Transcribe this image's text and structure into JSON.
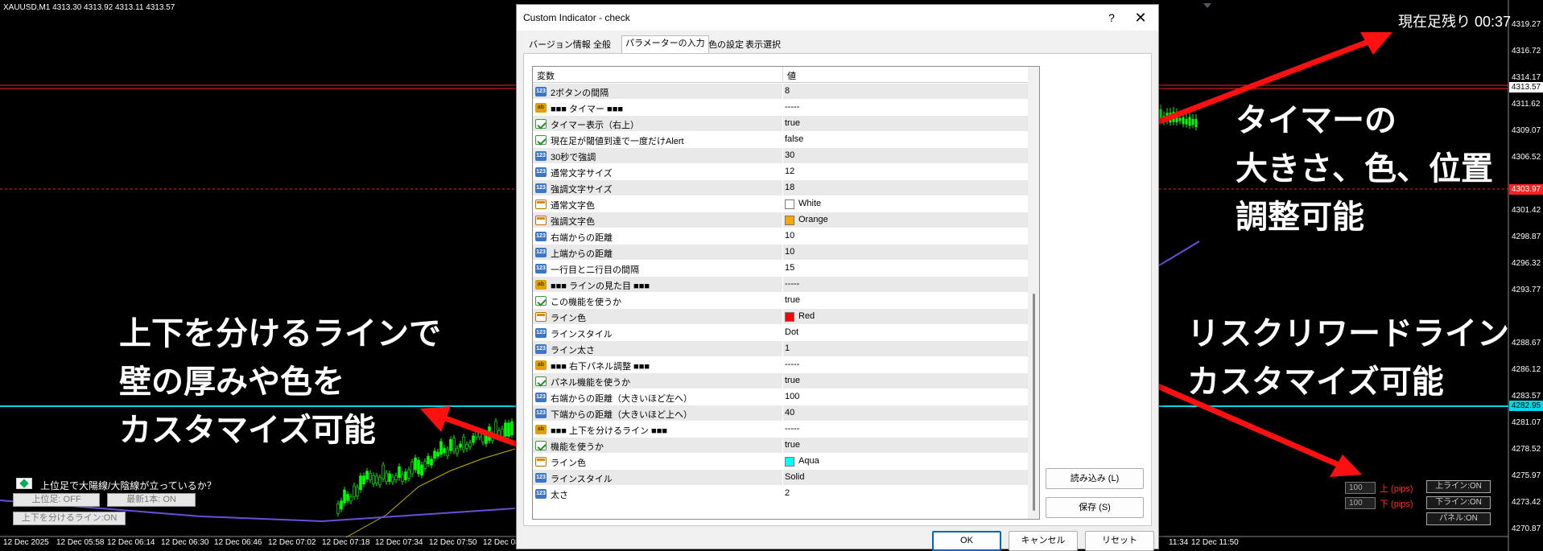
{
  "chart": {
    "symbol_info": "XAUUSD,M1  4313.30 4313.92 4313.11 4313.57",
    "timer_text": "現在足残り 00:37",
    "price_ticks": [
      "4319.27",
      "4316.72",
      "4314.17",
      "4311.62",
      "4309.07",
      "4306.52",
      "4301.42",
      "4298.87",
      "4296.32",
      "4293.77",
      "4288.67",
      "4286.12",
      "4283.57",
      "4281.07",
      "4278.52",
      "4275.97",
      "4273.42",
      "4270.87"
    ],
    "badges": {
      "current": "4313.57",
      "red_level": "4303.97",
      "aqua_level": "4282.95"
    },
    "time_ticks": [
      "12 Dec 2025",
      "12 Dec 05:58",
      "12 Dec 06:14",
      "12 Dec 06:30",
      "12 Dec 06:46",
      "12 Dec 07:02",
      "12 Dec 07:18",
      "12 Dec 07:34",
      "12 Dec 07:50",
      "12 Dec 08:06",
      "11:34",
      "12 Dec 11:50"
    ]
  },
  "annotations": {
    "timer_line1": "タイマーの",
    "timer_line2": "大きさ、色、位置",
    "timer_line3": "調整可能",
    "divider_line1": "上下を分けるラインで",
    "divider_line2": "壁の厚みや色を",
    "divider_line3": "カスタマイズ可能",
    "rr_line1": "リスクリワードライン",
    "rr_line2": "カスタマイズ可能"
  },
  "left_panel": {
    "question": "上位足で大陽線/大陰線が立っているか？",
    "btn_higher_tf": "上位足: OFF",
    "btn_latest": "最新1本: ON",
    "btn_divider": "上下を分けるライン:ON"
  },
  "right_panel": {
    "upper_value": "100",
    "upper_label": "上 (pips)",
    "lower_value": "100",
    "lower_label": "下 (pips)",
    "btn_upper_line": "上ライン:ON",
    "btn_lower_line": "下ライン:ON",
    "btn_panel": "パネル:ON"
  },
  "dialog": {
    "title": "Custom Indicator - check",
    "help": "?",
    "close": "✕",
    "tabs": [
      "バージョン情報",
      "全般",
      "パラメーターの入力",
      "色の設定",
      "表示選択"
    ],
    "active_tab": 2,
    "col_variable": "変数",
    "col_value": "値",
    "params": [
      {
        "type": "num",
        "name": "2ボタンの間隔",
        "value": "8"
      },
      {
        "type": "str",
        "name": "■■■ タイマー ■■■",
        "value": "-----"
      },
      {
        "type": "bool",
        "name": "タイマー表示（右上）",
        "value": "true"
      },
      {
        "type": "bool",
        "name": "現在足が閾値到達で一度だけAlert",
        "value": "false"
      },
      {
        "type": "num",
        "name": "30秒で強調",
        "value": "30"
      },
      {
        "type": "num",
        "name": "通常文字サイズ",
        "value": "12"
      },
      {
        "type": "num",
        "name": "強調文字サイズ",
        "value": "18"
      },
      {
        "type": "col",
        "name": "通常文字色",
        "value": "White",
        "color": "#ffffff"
      },
      {
        "type": "col",
        "name": "強調文字色",
        "value": "Orange",
        "color": "#ffa500"
      },
      {
        "type": "num",
        "name": "右端からの距離",
        "value": "10"
      },
      {
        "type": "num",
        "name": "上端からの距離",
        "value": "10"
      },
      {
        "type": "num",
        "name": "一行目と二行目の間隔",
        "value": "15"
      },
      {
        "type": "str",
        "name": "■■■ ラインの見た目 ■■■",
        "value": "-----"
      },
      {
        "type": "bool",
        "name": "この機能を使うか",
        "value": "true"
      },
      {
        "type": "col",
        "name": "ライン色",
        "value": "Red",
        "color": "#ff0000"
      },
      {
        "type": "num",
        "name": "ラインスタイル",
        "value": "Dot"
      },
      {
        "type": "num",
        "name": "ライン太さ",
        "value": "1"
      },
      {
        "type": "str",
        "name": "■■■ 右下パネル調整 ■■■",
        "value": "-----"
      },
      {
        "type": "bool",
        "name": "パネル機能を使うか",
        "value": "true"
      },
      {
        "type": "num",
        "name": "右端からの距離（大きいほど左へ）",
        "value": "100"
      },
      {
        "type": "num",
        "name": "下端からの距離（大きいほど上へ）",
        "value": "40"
      },
      {
        "type": "str",
        "name": "■■■ 上下を分けるライン ■■■",
        "value": "-----"
      },
      {
        "type": "bool",
        "name": "機能を使うか",
        "value": "true"
      },
      {
        "type": "col",
        "name": "ライン色",
        "value": "Aqua",
        "color": "#00ffff"
      },
      {
        "type": "num",
        "name": "ラインスタイル",
        "value": "Solid"
      },
      {
        "type": "num",
        "name": "太さ",
        "value": "2"
      }
    ],
    "btn_load": "読み込み (L)",
    "btn_save": "保存 (S)",
    "btn_ok": "OK",
    "btn_cancel": "キャンセル",
    "btn_reset": "リセット"
  },
  "colors": {
    "red_line": "#ff2020",
    "aqua_line": "#00d8e8",
    "arrow": "#ff1010",
    "candle": "#00ff00",
    "ma_yellow": "#c8b400",
    "ma_purple": "#6a4fd8"
  }
}
